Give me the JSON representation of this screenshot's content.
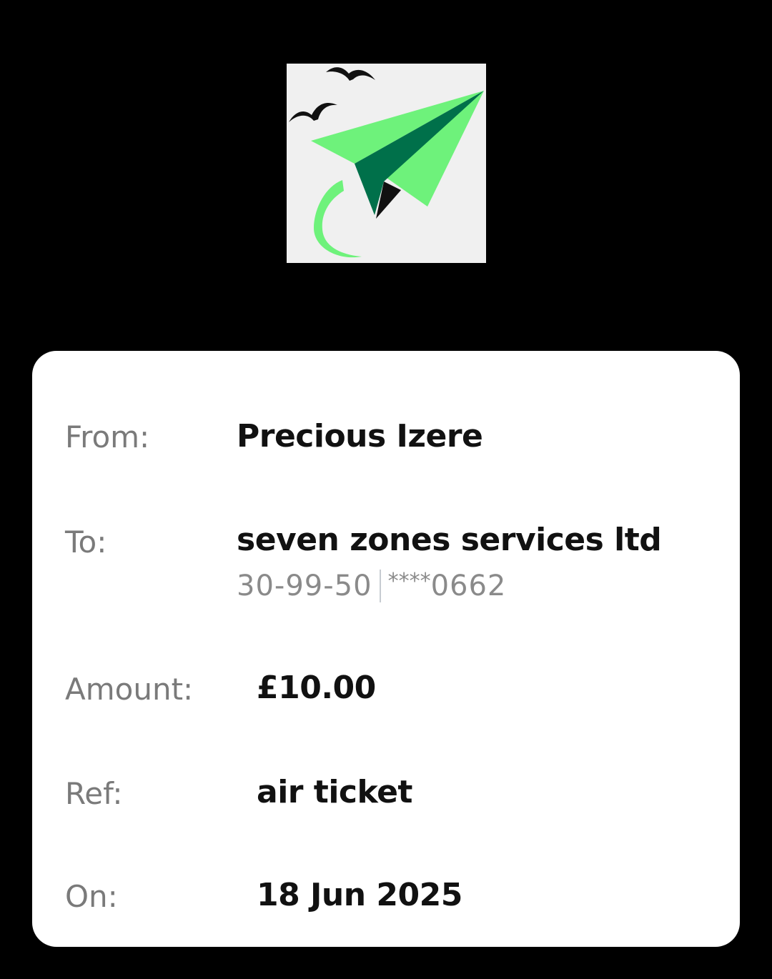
{
  "logo": {
    "icon": "paper-plane-logo-icon",
    "colors": {
      "background": "#f0f0f0",
      "light_green": "#6ef27b",
      "dark_green": "#00704a",
      "black": "#111111"
    }
  },
  "receipt": {
    "from": {
      "label": "From:",
      "value": "Precious Izere"
    },
    "to": {
      "label": "To:",
      "value": "seven zones services ltd",
      "sort_code": "30-99-50",
      "account_mask": "****",
      "account_last4": "0662"
    },
    "amount": {
      "label": "Amount:",
      "value": "£10.00"
    },
    "ref": {
      "label": "Ref:",
      "value": "air ticket"
    },
    "on": {
      "label": "On:",
      "value": "18 Jun 2025"
    }
  }
}
